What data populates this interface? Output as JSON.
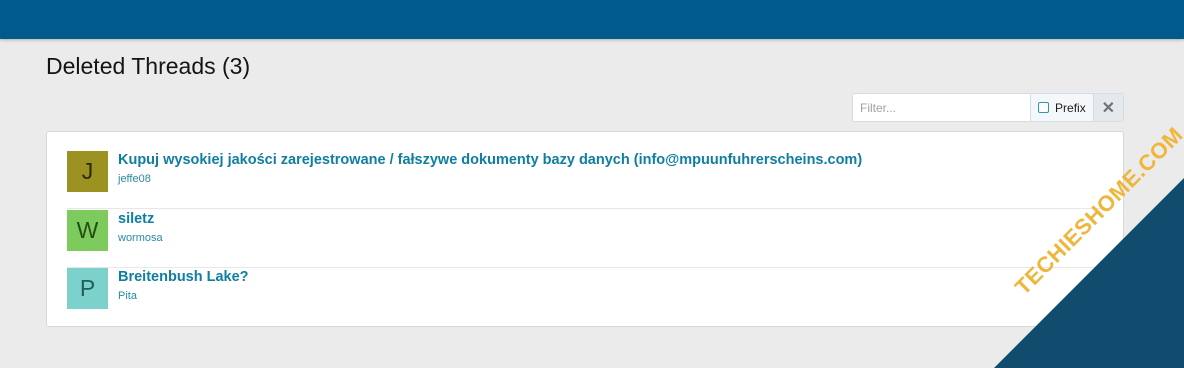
{
  "page": {
    "title": "Deleted Threads (3)"
  },
  "filter": {
    "placeholder": "Filter...",
    "prefix_label": "Prefix",
    "clear_symbol": "✕"
  },
  "threads": [
    {
      "avatar_letter": "J",
      "avatar_color": "#9b9221",
      "avatar_text_color": "#2b2b0a",
      "title": "Kupuj wysokiej jakości zarejestrowane / fałszywe dokumenty bazy danych (info@mpuunfuhrerscheins.com)",
      "author": "jeffe08"
    },
    {
      "avatar_letter": "W",
      "avatar_color": "#7dcb5c",
      "avatar_text_color": "#234f17",
      "title": "siletz",
      "author": "wormosa"
    },
    {
      "avatar_letter": "P",
      "avatar_color": "#7dd1cc",
      "avatar_text_color": "#1f5f5c",
      "title": "Breitenbush Lake?",
      "author": "Pita"
    }
  ],
  "watermark": {
    "text": "TECHIESHOME.COM"
  },
  "colors": {
    "header": "#005a8e",
    "link": "#0f7ea1"
  }
}
